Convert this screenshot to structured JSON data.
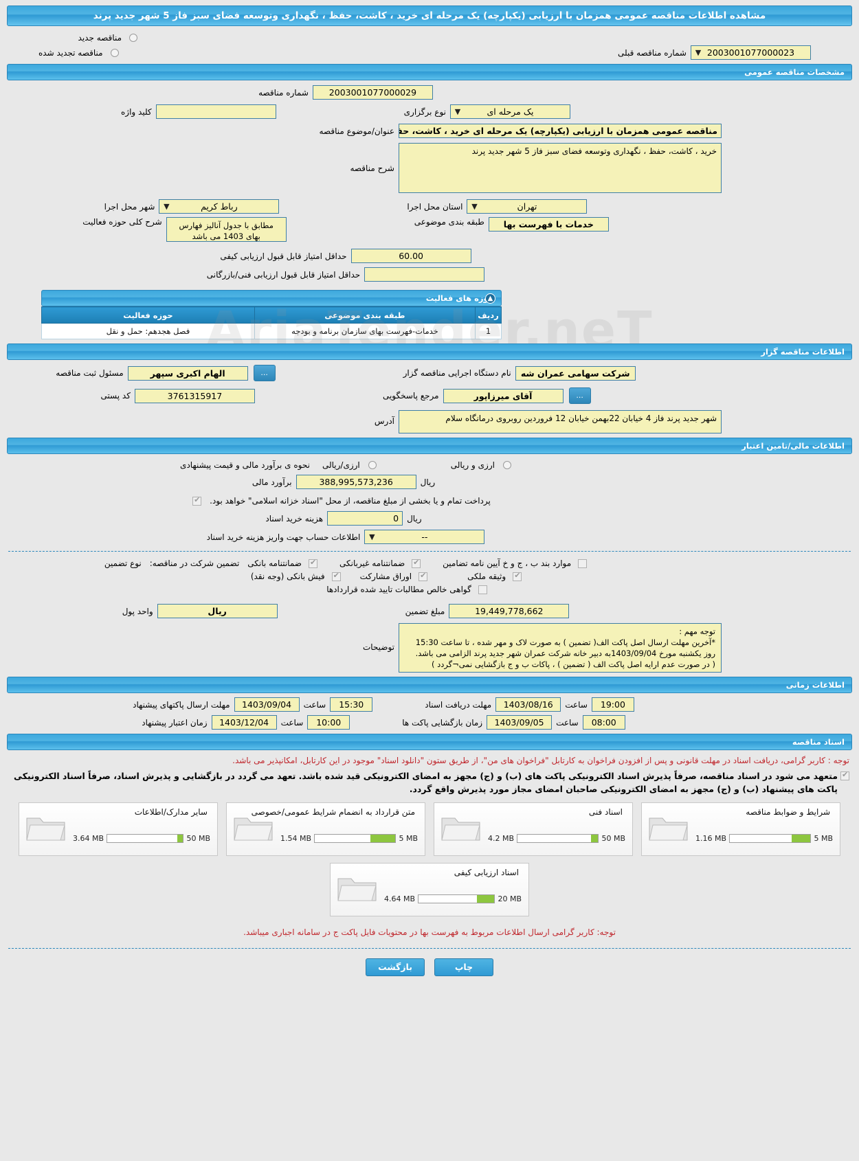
{
  "page_title": "مشاهده اطلاعات مناقصه عمومی همزمان با ارزیابی (یکپارچه) یک مرحله ای خرید ، کاشت، حفظ ، نگهداری وتوسعه فضای سبز فاز 5 شهر جدید پرند",
  "top": {
    "new_tender_label": "مناقصه جدید",
    "renewed_tender_label": "مناقصه تجدید شده",
    "previous_number_label": "شماره مناقصه قبلی",
    "previous_number_value": "2003001077000023"
  },
  "general": {
    "section_title": "مشخصات مناقصه عمومی",
    "tender_number_label": "شماره مناقصه",
    "tender_number_value": "2003001077000029",
    "process_type_label": "نوع برگزاری",
    "process_type_value": "یک مرحله ای",
    "keyword_label": "کلید واژه",
    "keyword_value": "",
    "subject_label": "عنوان/موضوع مناقصه",
    "subject_value": "مناقصه عمومی همزمان با ارزیابی (یکپارچه) یک مرحله ای خرید ، کاشت، حفظ ، نگهداری وتوسعه فض",
    "description_label": "شرح مناقصه",
    "description_value": "خرید ، کاشت، حفظ ، نگهداری وتوسعه فضای سبز فاز 5 شهر جدید پرند",
    "province_label": "استان محل اجرا",
    "province_value": "تهران",
    "city_label": "شهر محل اجرا",
    "city_value": "رباط کریم",
    "classification_label": "طبقه بندی موضوعی",
    "classification_value": "خدمات با فهرست بها",
    "activity_scope_label": "شرح کلی حوزه فعالیت",
    "activity_scope_value": "مطابق با جدول آنالیز فهارس بهای 1403 می باشد",
    "min_quality_label": "حداقل امتیاز قابل قبول ارزیابی کیفی",
    "min_quality_value": "60.00",
    "min_tech_label": "حداقل امتیاز قابل قبول ارزیابی فنی/بازرگانی",
    "min_tech_value": ""
  },
  "activity_table": {
    "section_title": "حوزه های فعالیت",
    "columns": [
      "ردیف",
      "طبقه بندی موضوعی",
      "حوزه فعالیت"
    ],
    "rows": [
      {
        "index": "1",
        "classification": "خدمات-فهرست بهای سازمان برنامه و بودجه",
        "scope": "فصل هجدهم: حمل و نقل"
      }
    ]
  },
  "authority": {
    "section_title": "اطلاعات مناقصه گزار",
    "org_label": "نام دستگاه اجرایی مناقصه گزار",
    "org_value": "شرکت سهامی عمران شه",
    "registrar_label": "مسئول ثبت مناقصه",
    "registrar_value": "الهام  اکبری سپهر",
    "contact_label": "مرجع پاسخگویی",
    "contact_value": "آقای میرزاپور",
    "postal_label": "کد پستی",
    "postal_value": "3761315917",
    "address_label": "آدرس",
    "address_value": "شهر جدید پرند فاز 4 خیابان 22بهمن خیابان 12 فروردین روبروی درمانگاه سلام",
    "more_button": "..."
  },
  "finance": {
    "section_title": "اطلاعات مالی/تامین اعتبار",
    "estimate_method_label": "نحوه ی برآورد مالی و قیمت پیشنهادی",
    "option_rial": "ارزی/ریالی",
    "option_rial_and_currency": "ارزی و ریالی",
    "estimate_label": "برآورد مالی",
    "estimate_value": "388,995,573,236",
    "currency_unit": "ریال",
    "treasury_note": "پرداخت تمام و یا بخشی از مبلغ مناقصه، از محل \"اسناد خزانه اسلامی\" خواهد بود.",
    "doc_cost_label": "هزینه خرید اسناد",
    "doc_cost_value": "0",
    "account_label": "اطلاعات حساب جهت واریز هزینه خرید اسناد",
    "account_value": "--"
  },
  "guarantee": {
    "type_label": "نوع تضمین",
    "participation_label": "تضمین شرکت در مناقصه:",
    "options": [
      {
        "label": "ضمانتنامه بانکی",
        "checked": true
      },
      {
        "label": "ضمانتنامه غیربانکی",
        "checked": true
      },
      {
        "label": "موارد بند ب ، ج و خ آیین نامه تضامین",
        "checked": false
      },
      {
        "label": "فیش بانکی (وجه نقد)",
        "checked": true
      },
      {
        "label": "اوراق مشارکت",
        "checked": true
      },
      {
        "label": "وثیقه ملکی",
        "checked": true
      },
      {
        "label": "گواهی خالص مطالبات تایید شده قراردادها",
        "checked": false
      }
    ],
    "amount_label": "مبلغ تضمین",
    "amount_value": "19,449,778,662",
    "unit_label": "واحد پول",
    "unit_value": "ریال",
    "notes_label": "توضیحات",
    "notes_value": "توجه مهم :\n*آخرین مهلت ارسال اصل پاکت الف( تضمین ) به صورت لاک و مهر شده ، تا ساعت 15:30 روز یکشنبه مورخ 1403/09/04به دبیر خانه شرکت عمران شهر جدید پرند الزامی می باشد. ( در صورت عدم ارایه اصل پاکت الف ( تضمین ) ، پاکات ب و ج بازگشایی نمی¬گردد )"
  },
  "timing": {
    "section_title": "اطلاعات زمانی",
    "hour_label": "ساعت",
    "rows": [
      {
        "label": "مهلت دریافت اسناد",
        "date": "1403/08/16",
        "time": "19:00"
      },
      {
        "label": "مهلت ارسال پاکتهای پیشنهاد",
        "date": "1403/09/04",
        "time": "15:30"
      },
      {
        "label": "زمان بازگشایی پاکت ها",
        "date": "1403/09/05",
        "time": "08:00"
      },
      {
        "label": "زمان اعتبار پیشنهاد",
        "date": "1403/12/04",
        "time": "10:00"
      }
    ]
  },
  "documents": {
    "section_title": "اسناد مناقصه",
    "note_red": "توجه : کاربر گرامی، دریافت اسناد در مهلت قانونی و پس از افزودن فراخوان به کارتابل \"فراخوان های من\"، از طریق ستون \"دانلود اسناد\" موجود در این کارتابل، امکانپذیر می باشد.",
    "note_black": "متعهد می شود در اسناد مناقصه، صرفاً پذیرش اسناد الکترونیکی پاکت های (ب) و (ج) مجهز به امضای الکترونیکی قید شده باشد. تعهد می گردد در بازگشایی و پذیرش اسناد، صرفاً اسناد الکترونیکی پاکت های پیشنهاد (ب) و (ج) مجهز به امضای الکترونیکی صاحبان امضای مجاز مورد پذیرش واقع گردد.",
    "cards": [
      {
        "title": "شرایط و ضوابط مناقصه",
        "size": "1.16 MB",
        "max": "5 MB",
        "fill_pct": 23
      },
      {
        "title": "اسناد فنی",
        "size": "4.2 MB",
        "max": "50 MB",
        "fill_pct": 9
      },
      {
        "title": "متن قرارداد به انضمام شرایط عمومی/خصوصی",
        "size": "1.54 MB",
        "max": "5 MB",
        "fill_pct": 31
      },
      {
        "title": "سایر مدارک/اطلاعات",
        "size": "3.64 MB",
        "max": "50 MB",
        "fill_pct": 8
      },
      {
        "title": "اسناد ارزیابی کیفی",
        "size": "4.64 MB",
        "max": "20 MB",
        "fill_pct": 23
      }
    ],
    "footer_note": "توجه: کاربر گرامی ارسال اطلاعات مربوط به فهرست بها در محتویات فایل پاکت ج در سامانه اجباری میباشد."
  },
  "footer": {
    "back_label": "بازگشت",
    "print_label": "چاپ"
  },
  "watermark": "AriaTender.neT"
}
